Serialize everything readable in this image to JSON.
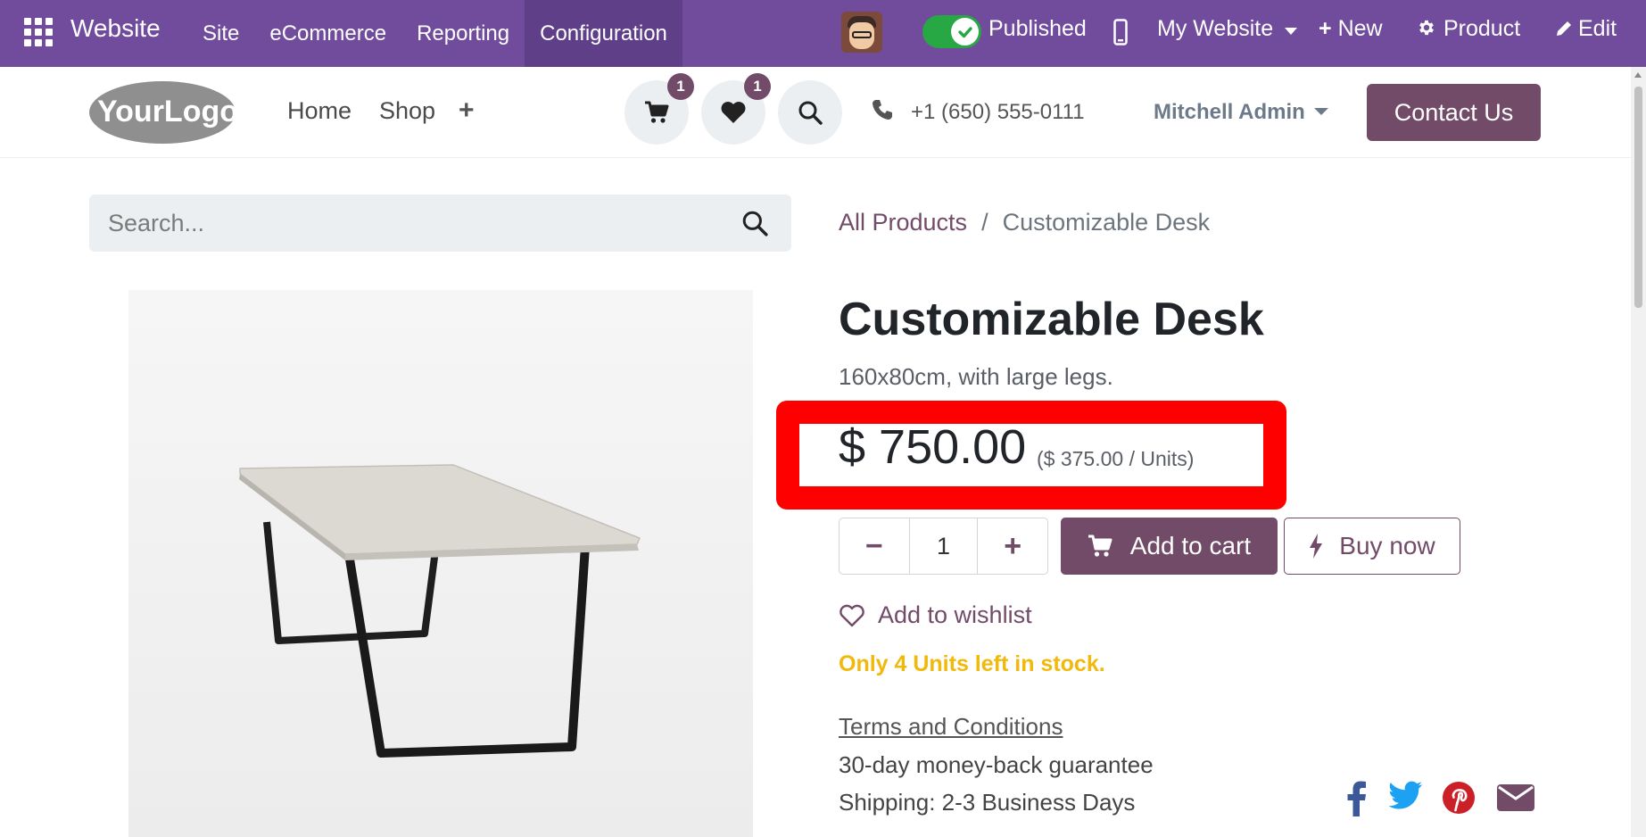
{
  "topbar": {
    "brand": "Website",
    "menu": [
      "Site",
      "eCommerce",
      "Reporting",
      "Configuration"
    ],
    "published_label": "Published",
    "website_selector": "My Website",
    "new_label": "New",
    "product_label": "Product",
    "edit_label": "Edit",
    "accent": "#714b9c"
  },
  "header": {
    "logo_text": "YourLogo",
    "nav": [
      "Home",
      "Shop"
    ],
    "cart_count": "1",
    "wishlist_count": "1",
    "phone": "+1 (650) 555-0111",
    "user": "Mitchell Admin",
    "contact_label": "Contact Us",
    "brand_color": "#714b67"
  },
  "search": {
    "placeholder": "Search..."
  },
  "breadcrumb": {
    "parent": "All Products",
    "separator": "/",
    "current": "Customizable Desk"
  },
  "product": {
    "name": "Customizable Desk",
    "description": "160x80cm, with large legs.",
    "price": "$ 750.00",
    "unit_price": "($ 375.00 / Units)",
    "quantity": "1",
    "qty_minus": "−",
    "qty_plus": "+",
    "add_to_cart": "Add to cart",
    "buy_now": "Buy now",
    "add_to_wishlist": "Add to wishlist",
    "stock_message": "Only 4 Units left in stock.",
    "terms": "Terms and Conditions",
    "guarantee": "30-day money-back guarantee",
    "shipping": "Shipping: 2-3 Business Days",
    "stock_color": "#f0b90b"
  },
  "social": [
    "facebook-icon",
    "twitter-icon",
    "pinterest-icon",
    "email-icon"
  ]
}
